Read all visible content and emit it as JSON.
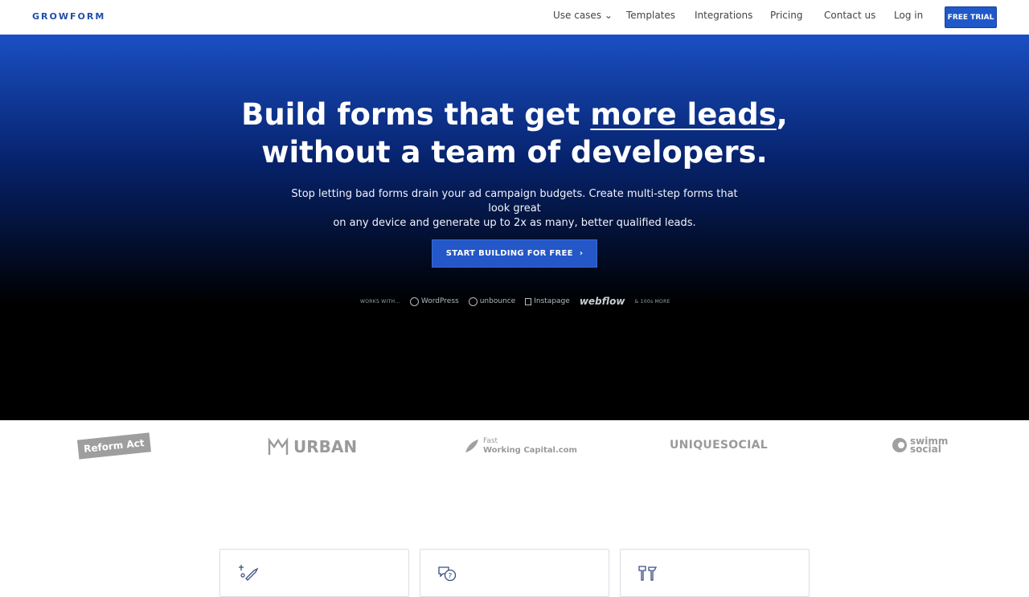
{
  "header": {
    "brand": "GROWFORM",
    "nav": [
      {
        "label": "Use cases ⌄"
      },
      {
        "label": "Templates"
      },
      {
        "label": "Integrations"
      },
      {
        "label": "Pricing"
      },
      {
        "label": "Contact us"
      },
      {
        "label": "Log in"
      }
    ],
    "cta": "FREE TRIAL"
  },
  "hero": {
    "title_pre": "Build forms that get ",
    "title_highlight": "more leads",
    "title_post": ",",
    "title_line2": "without a team of developers.",
    "subtitle_line1": "Stop letting bad forms drain your ad campaign budgets. Create multi-step forms that look great",
    "subtitle_line2": "on any device and generate up to 2x as many, better qualified leads.",
    "button": "START BUILDING FOR FREE",
    "works_with_label": "WORKS WITH...",
    "works_with_more": "& 100s MORE",
    "partners": [
      "WordPress",
      "unbounce",
      "Instapage",
      "webflow"
    ]
  },
  "clients": [
    "Reform Act",
    "URBAN",
    "Fast",
    "Working Capital.com",
    "UNIQUESOCIAL",
    "swimm",
    "social"
  ],
  "colors": {
    "brand": "#1f4ea8",
    "accent": "#2457c7"
  }
}
